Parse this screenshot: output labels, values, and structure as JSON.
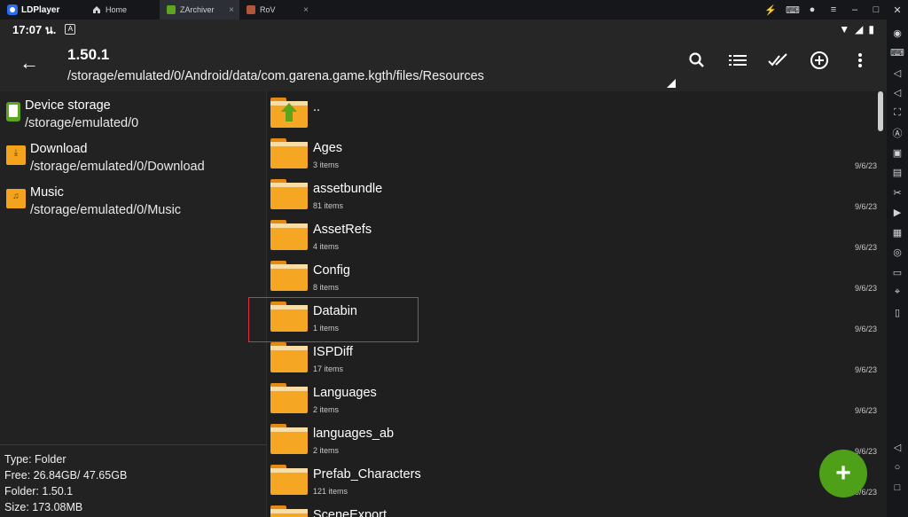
{
  "window": {
    "app_name": "LDPlayer",
    "tabs": [
      {
        "label": "Home"
      },
      {
        "label": "ZArchiver"
      },
      {
        "label": "RoV"
      }
    ],
    "close_glyph": "×"
  },
  "statusbar": {
    "time": "17:07 น.",
    "a_badge": "A"
  },
  "appbar": {
    "title": "1.50.1",
    "path": "/storage/emulated/0/Android/data/com.garena.game.kgth/files/Resources",
    "actions": [
      "search-icon",
      "list-view-icon",
      "multi-select-icon",
      "add-circle-icon",
      "more-vert-icon"
    ]
  },
  "locations": [
    {
      "name": "Device storage",
      "path": "/storage/emulated/0",
      "icon": "device-storage-icon"
    },
    {
      "name": "Download",
      "path": "/storage/emulated/0/Download",
      "icon": "download-folder-icon"
    },
    {
      "name": "Music",
      "path": "/storage/emulated/0/Music",
      "icon": "music-folder-icon"
    }
  ],
  "info": {
    "type": "Type: Folder",
    "free": "Free: 26.84GB/ 47.65GB",
    "folder": "Folder: 1.50.1",
    "size": "Size: 173.08MB"
  },
  "files": [
    {
      "name": "..",
      "sub": "",
      "date": ""
    },
    {
      "name": "Ages",
      "sub": "3 items",
      "date": "9/6/23"
    },
    {
      "name": "assetbundle",
      "sub": "81 items",
      "date": "9/6/23"
    },
    {
      "name": "AssetRefs",
      "sub": "4 items",
      "date": "9/6/23"
    },
    {
      "name": "Config",
      "sub": "8 items",
      "date": "9/6/23"
    },
    {
      "name": "Databin",
      "sub": "1 items",
      "date": "9/6/23"
    },
    {
      "name": "ISPDiff",
      "sub": "17 items",
      "date": "9/6/23"
    },
    {
      "name": "Languages",
      "sub": "2 items",
      "date": "9/6/23"
    },
    {
      "name": "languages_ab",
      "sub": "2 items",
      "date": "9/6/23"
    },
    {
      "name": "Prefab_Characters",
      "sub": "121 items",
      "date": "9/6/23"
    },
    {
      "name": "SceneExport",
      "sub": "",
      "date": ""
    }
  ],
  "highlighted_file": "Databin",
  "fab_label": "+",
  "colors": {
    "folder": "#f5a623",
    "accent_green": "#4ea018",
    "highlight_border": "#e0303a"
  }
}
